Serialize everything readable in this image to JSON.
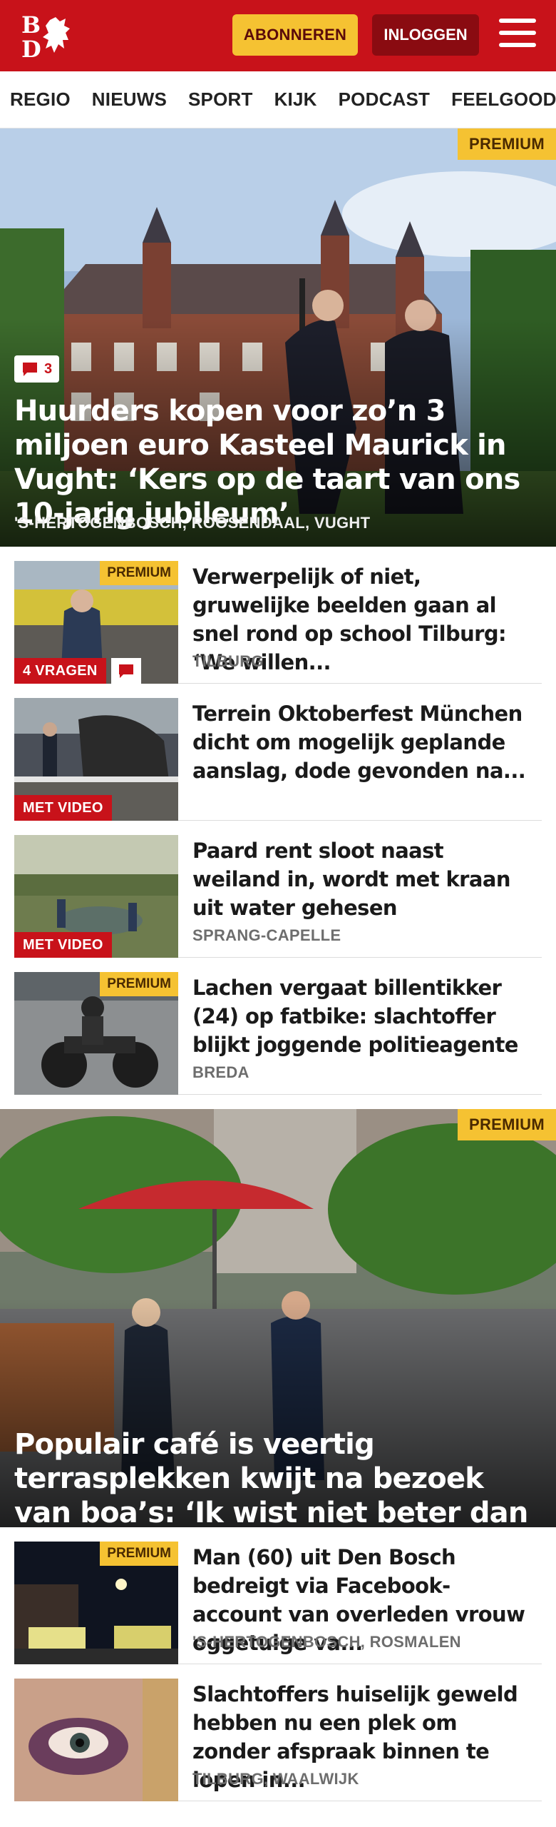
{
  "header": {
    "logo_text": "BD",
    "subscribe_label": "ABONNEREN",
    "login_label": "INLOGGEN",
    "colors": {
      "brand": "#c8121a",
      "subscribe": "#f5c232",
      "login": "#8a0b11"
    }
  },
  "nav": {
    "items": [
      "REGIO",
      "NIEUWS",
      "SPORT",
      "KIJK",
      "PODCAST",
      "FEELGOOD"
    ]
  },
  "hero1": {
    "premium": "PREMIUM",
    "comments": "3",
    "title": "Huurders kopen voor zo’n 3 miljoen euro Kasteel Maurick in Vught: ‘Kers op de taart van ons 10-jarig jubileum’",
    "location": "'S-HERTOGENBOSCH, ROOSENDAAL, VUGHT"
  },
  "articles1": [
    {
      "title": "Verwerpelijk of niet, gruwelijke beelden gaan al snel rond op school Tilburg: ‘We willen...",
      "location": "TILBURG",
      "premium": "PREMIUM",
      "label": "4 VRAGEN"
    },
    {
      "title": "Terrein Oktoberfest München dicht om mogelijk geplande aanslag, dode gevonden na...",
      "location": "",
      "premium": "",
      "label": "MET VIDEO"
    },
    {
      "title": "Paard rent sloot naast weiland in, wordt met kraan uit water gehesen",
      "location": "SPRANG-CAPELLE",
      "premium": "",
      "label": "MET VIDEO"
    },
    {
      "title": "Lachen vergaat billentikker (24) op fatbike: slachtoffer blijkt joggende politieagente",
      "location": "BREDA",
      "premium": "PREMIUM",
      "label": ""
    }
  ],
  "hero2": {
    "premium": "PREMIUM",
    "title": "Populair café is veertig terrasplekken kwijt na bezoek van boa’s: ‘Ik wist niet beter dan dat dit mocht’"
  },
  "articles2": [
    {
      "title": "Man (60) uit Den Bosch bedreigt via Facebook-account van overleden vrouw oggetuige va...",
      "location": "'S-HERTOGENBOSCH, ROSMALEN",
      "premium": "PREMIUM"
    },
    {
      "title": "Slachtoffers huiselijk geweld hebben nu een plek om zonder afspraak binnen te lopen in...",
      "location": "TILBURG, WAALWIJK",
      "premium": ""
    }
  ]
}
